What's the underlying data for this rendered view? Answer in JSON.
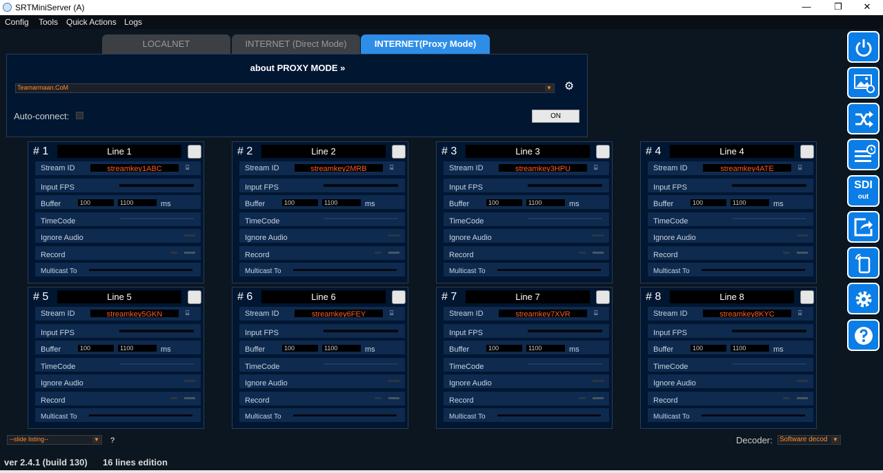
{
  "window": {
    "title": "SRTMiniServer (A)",
    "minimize": "—",
    "maximize": "❐",
    "close": "✕"
  },
  "menu": [
    "Config",
    "Tools",
    "Quick Actions",
    "Logs"
  ],
  "tabs": [
    {
      "label": "LOCALNET",
      "active": false
    },
    {
      "label": "INTERNET (Direct Mode)",
      "active": false
    },
    {
      "label": "INTERNET(Proxy Mode)",
      "active": true
    }
  ],
  "proxy": {
    "about": "about PROXY MODE »",
    "server": "Teamarmaan.CoM",
    "auto_connect_label": "Auto-connect:",
    "on_button": "ON"
  },
  "row_labels": {
    "stream_id": "Stream ID",
    "input_fps": "Input FPS",
    "buffer": "Buffer",
    "buffer_unit": "ms",
    "timecode": "TimeCode",
    "ignore_audio": "Ignore Audio",
    "record": "Record",
    "multicast": "Multicast To"
  },
  "lines": [
    {
      "num": "# 1",
      "name": "Line 1",
      "stream_id": "streamkey1ABC",
      "buf_min": "100",
      "buf_max": "1100"
    },
    {
      "num": "# 2",
      "name": "Line 2",
      "stream_id": "streamkey2MRB",
      "buf_min": "100",
      "buf_max": "1100"
    },
    {
      "num": "# 3",
      "name": "Line 3",
      "stream_id": "streamkey3HPU",
      "buf_min": "100",
      "buf_max": "1100"
    },
    {
      "num": "# 4",
      "name": "Line 4",
      "stream_id": "streamkey4ATE",
      "buf_min": "100",
      "buf_max": "1100"
    },
    {
      "num": "# 5",
      "name": "Line 5",
      "stream_id": "streamkey5GKN",
      "buf_min": "100",
      "buf_max": "1100"
    },
    {
      "num": "# 6",
      "name": "Line 6",
      "stream_id": "streamkey6FEY",
      "buf_min": "100",
      "buf_max": "1100"
    },
    {
      "num": "# 7",
      "name": "Line 7",
      "stream_id": "streamkey7XVR",
      "buf_min": "100",
      "buf_max": "1100"
    },
    {
      "num": "# 8",
      "name": "Line 8",
      "stream_id": "streamkey8KYC",
      "buf_min": "100",
      "buf_max": "1100"
    }
  ],
  "sidebar": [
    {
      "name": "power-icon"
    },
    {
      "name": "image-settings-icon"
    },
    {
      "name": "shuffle-icon"
    },
    {
      "name": "schedule-list-icon"
    },
    {
      "name": "sdi-out-icon",
      "label": "SDI",
      "sub": "out"
    },
    {
      "name": "share-icon"
    },
    {
      "name": "mobile-signal-icon"
    },
    {
      "name": "gear-icon"
    },
    {
      "name": "help-icon"
    }
  ],
  "bottom": {
    "slide_listing": "--slide listing--",
    "help": "?",
    "decoder_label": "Decoder:",
    "decoder_value": "Software decod",
    "version": "ver 2.4.1 (build 130)",
    "edition": "16 lines edition"
  },
  "colors": {
    "accent": "#2e8de8",
    "panel": "#001631",
    "stream_text": "#ff5a1f",
    "select_text": "#ff8c2a"
  }
}
